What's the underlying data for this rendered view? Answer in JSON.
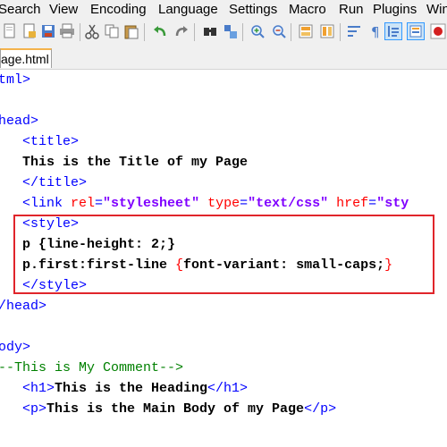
{
  "menubar": {
    "items": [
      "Search",
      "View",
      "Encoding",
      "Language",
      "Settings",
      "Macro",
      "Run",
      "Plugins",
      "Win"
    ]
  },
  "tab": {
    "label": "age.html"
  },
  "editor": {
    "lines": [
      {
        "parts": [
          [
            "tag",
            "tml>"
          ]
        ]
      },
      {
        "parts": []
      },
      {
        "parts": [
          [
            "tag",
            "head>"
          ]
        ]
      },
      {
        "parts": [
          [
            "tag",
            "<title>"
          ]
        ]
      },
      {
        "parts": [
          [
            "text",
            "This is the Title of my Page"
          ]
        ]
      },
      {
        "parts": [
          [
            "tag",
            "</title>"
          ]
        ]
      },
      {
        "parts": [
          [
            "tag",
            "<link "
          ],
          [
            "attr",
            "rel"
          ],
          [
            "tag",
            "="
          ],
          [
            "val",
            "\"stylesheet\""
          ],
          [
            "tag",
            " "
          ],
          [
            "attr",
            "type"
          ],
          [
            "tag",
            "="
          ],
          [
            "val",
            "\"text/css\""
          ],
          [
            "tag",
            " "
          ],
          [
            "attr",
            "href"
          ],
          [
            "tag",
            "="
          ],
          [
            "val",
            "\"sty"
          ]
        ]
      },
      {
        "parts": [
          [
            "tag",
            "<style>"
          ]
        ]
      },
      {
        "parts": [
          [
            "text",
            "p {line-height: 2;}"
          ]
        ]
      },
      {
        "parts": [
          [
            "text",
            "p.first:first-line "
          ],
          [
            "sel",
            "{"
          ],
          [
            "text",
            "font-variant: small-caps;"
          ],
          [
            "sel",
            "}"
          ]
        ]
      },
      {
        "parts": [
          [
            "tag",
            "</style>"
          ]
        ]
      },
      {
        "parts": [
          [
            "tag",
            "/head>"
          ]
        ]
      },
      {
        "parts": []
      },
      {
        "parts": [
          [
            "tag",
            "ody>"
          ]
        ]
      },
      {
        "parts": [
          [
            "comment",
            "--This is My Comment-->"
          ]
        ]
      },
      {
        "parts": [
          [
            "tag",
            "<h1>"
          ],
          [
            "text",
            "This is the Heading"
          ],
          [
            "tag",
            "</h1>"
          ]
        ]
      },
      {
        "parts": [
          [
            "tag",
            "<p>"
          ],
          [
            "text",
            "This is the Main Body of my Page"
          ],
          [
            "tag",
            "</p>"
          ]
        ]
      }
    ]
  }
}
